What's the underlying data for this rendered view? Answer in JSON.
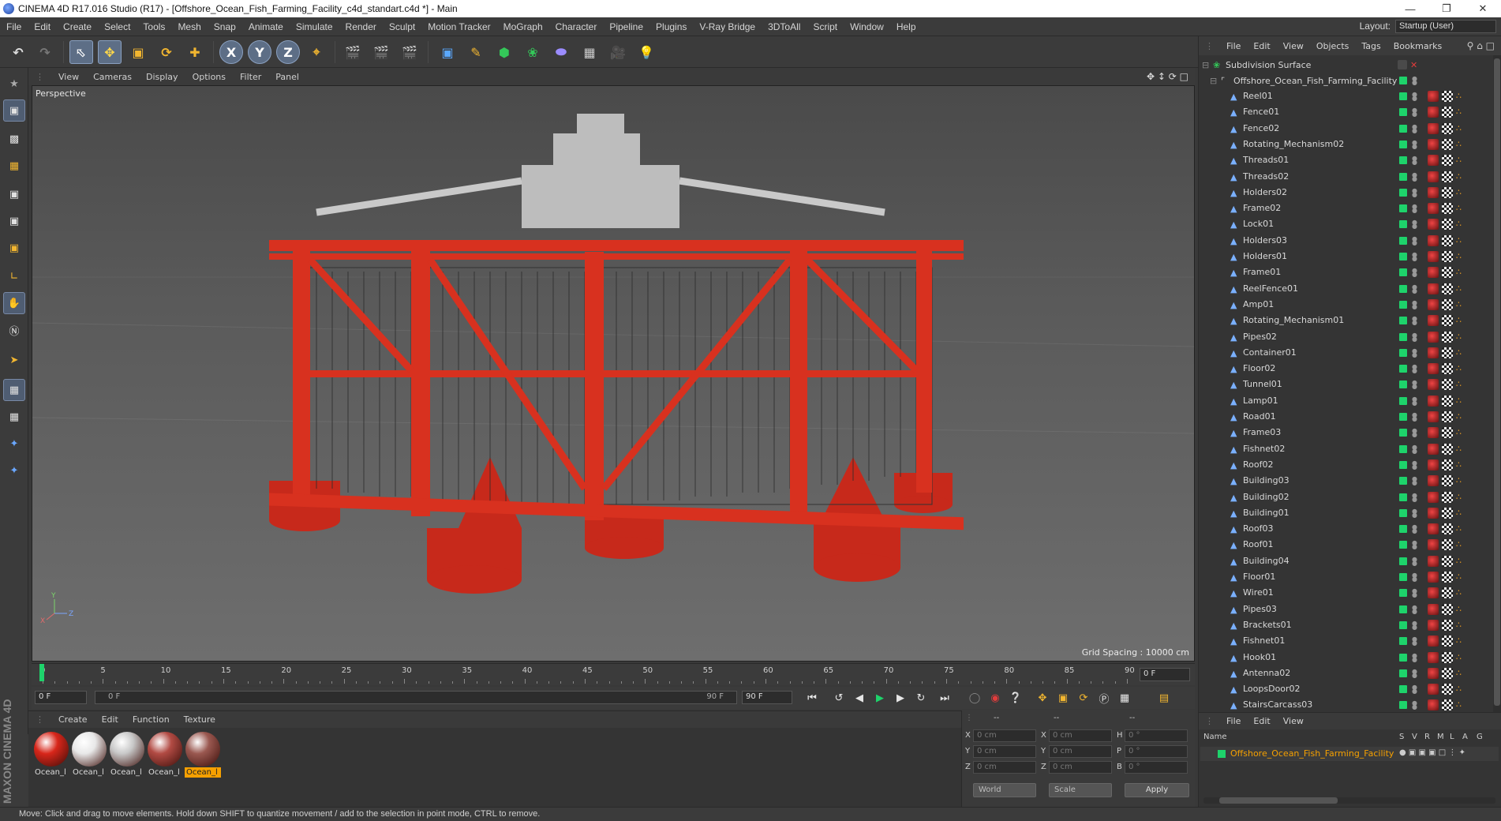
{
  "window": {
    "title": "CINEMA 4D R17.016 Studio (R17) - [Offshore_Ocean_Fish_Farming_Facility_c4d_standart.c4d *] - Main"
  },
  "menu": [
    "File",
    "Edit",
    "Create",
    "Select",
    "Tools",
    "Mesh",
    "Snap",
    "Animate",
    "Simulate",
    "Render",
    "Sculpt",
    "Motion Tracker",
    "MoGraph",
    "Character",
    "Pipeline",
    "Plugins",
    "V-Ray Bridge",
    "3DToAll",
    "Script",
    "Window",
    "Help"
  ],
  "layout": {
    "label": "Layout:",
    "value": "Startup (User)"
  },
  "viewport": {
    "menu": [
      "View",
      "Cameras",
      "Display",
      "Options",
      "Filter",
      "Panel"
    ],
    "label": "Perspective",
    "grid_spacing": "Grid Spacing : 10000 cm"
  },
  "timeline": {
    "ticks": [
      "0",
      "5",
      "10",
      "15",
      "20",
      "25",
      "30",
      "35",
      "40",
      "45",
      "50",
      "55",
      "60",
      "65",
      "70",
      "75",
      "80",
      "85",
      "90"
    ],
    "end_frame_label": "0 F",
    "start_field": "0 F",
    "range_start": "0 F",
    "range_end": "90 F",
    "end_field": "90 F"
  },
  "materials": {
    "menu": [
      "Create",
      "Edit",
      "Function",
      "Texture"
    ],
    "items": [
      {
        "label": "Ocean_l",
        "color": "#d8261a"
      },
      {
        "label": "Ocean_l",
        "color": "#e8e8e8"
      },
      {
        "label": "Ocean_l",
        "color": "#c8c8c8"
      },
      {
        "label": "Ocean_l",
        "color": "#b24b44"
      },
      {
        "label": "Ocean_l",
        "color": "#9a5850"
      }
    ]
  },
  "coordinates": {
    "header": [
      "--",
      "--",
      "--"
    ],
    "rows": [
      {
        "a": "X",
        "av": "0 cm",
        "b": "X",
        "bv": "0 cm",
        "c": "H",
        "cv": "0 °"
      },
      {
        "a": "Y",
        "av": "0 cm",
        "b": "Y",
        "bv": "0 cm",
        "c": "P",
        "cv": "0 °"
      },
      {
        "a": "Z",
        "av": "0 cm",
        "b": "Z",
        "bv": "0 cm",
        "c": "B",
        "cv": "0 °"
      }
    ],
    "world": "World",
    "scale": "Scale",
    "apply": "Apply"
  },
  "logo": "MAXON CINEMA 4D",
  "status": "Move: Click and drag to move elements. Hold down SHIFT to quantize movement / add to the selection in point mode, CTRL to remove.",
  "objects": {
    "menu": [
      "File",
      "Edit",
      "View",
      "Objects",
      "Tags",
      "Bookmarks"
    ],
    "root": "Subdivision Surface",
    "group": "Offshore_Ocean_Fish_Farming_Facility",
    "items": [
      "Reel01",
      "Fence01",
      "Fence02",
      "Rotating_Mechanism02",
      "Threads01",
      "Threads02",
      "Holders02",
      "Frame02",
      "Lock01",
      "Holders03",
      "Holders01",
      "Frame01",
      "ReelFence01",
      "Amp01",
      "Rotating_Mechanism01",
      "Pipes02",
      "Container01",
      "Floor02",
      "Tunnel01",
      "Lamp01",
      "Road01",
      "Frame03",
      "Fishnet02",
      "Roof02",
      "Building03",
      "Building02",
      "Building01",
      "Roof03",
      "Roof01",
      "Building04",
      "Floor01",
      "Wire01",
      "Pipes03",
      "Brackets01",
      "Fishnet01",
      "Hook01",
      "Antenna02",
      "LoopsDoor02",
      "StairsCarcass03"
    ]
  },
  "attributes": {
    "menu": [
      "File",
      "Edit",
      "View"
    ],
    "columns": [
      "Name",
      "S",
      "V",
      "R",
      "M",
      "L",
      "A",
      "G"
    ],
    "row": "Offshore_Ocean_Fish_Farming_Facility"
  }
}
